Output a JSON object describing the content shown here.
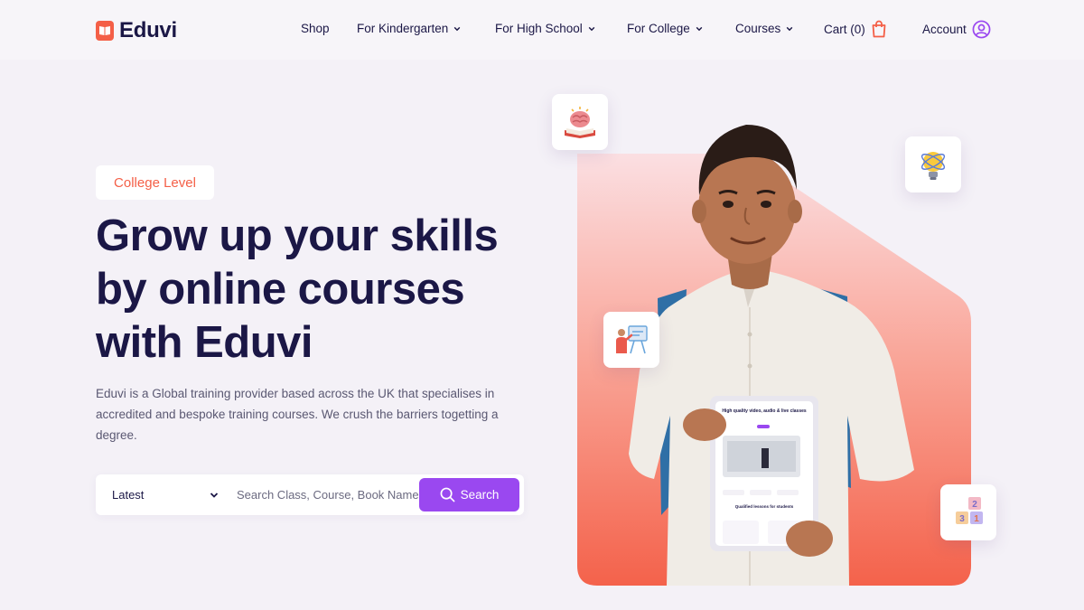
{
  "brand": {
    "name": "Eduvi",
    "accent": "#f45f47",
    "primary": "#9a48f0",
    "text": "#1b1746"
  },
  "nav": {
    "items": [
      {
        "label": "Shop",
        "has_dropdown": false
      },
      {
        "label": "For Kindergarten",
        "has_dropdown": true
      },
      {
        "label": "For High School",
        "has_dropdown": true
      },
      {
        "label": "For College",
        "has_dropdown": true
      },
      {
        "label": "Courses",
        "has_dropdown": true
      }
    ],
    "cart_label": "Cart (0)",
    "account_label": "Account"
  },
  "hero": {
    "badge": "College Level",
    "headline_lines": [
      "Grow up your skills",
      "by online courses",
      "with Eduvi"
    ],
    "description": "Eduvi is a Global training provider based across the UK that specialises in accredited and bespoke training courses. We crush the barriers togetting a degree.",
    "search": {
      "select_value": "Latest",
      "placeholder": "Search Class, Course, Book Name",
      "button_label": "Search"
    },
    "floating_icons": [
      "brain-book-icon",
      "lightbulb-atom-icon",
      "teacher-board-icon",
      "number-blocks-icon"
    ],
    "tablet": {
      "title": "High quality video, audio & live classes",
      "subtitle": "Qualified lessons for students"
    }
  }
}
